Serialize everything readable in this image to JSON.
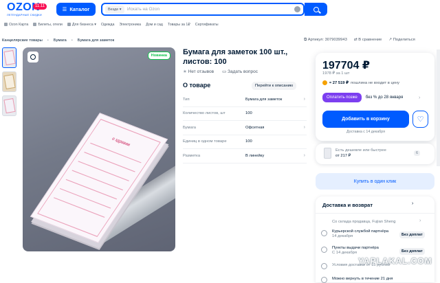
{
  "header": {
    "logo_word": "OZON",
    "logo_tag": "11.11",
    "logo_sub": "ЛЕГЕНДАРНЫЕ СКИДКИ",
    "catalog_label": "Каталог",
    "search_scope": "Везде",
    "search_placeholder": "Искать на Ozon"
  },
  "nav": [
    "Ozon Карта",
    "Билеты, отели",
    "Для бизнеса",
    "Одежда",
    "Электроника",
    "Дом и сад",
    "Товары за 1₽",
    "Сертификаты"
  ],
  "breadcrumbs": [
    "Канцелярские товары",
    "Бумага",
    "Бумага для заметок"
  ],
  "actions": {
    "article": "Артикул: 3079039943",
    "compare": "В сравнение",
    "share": "Поделиться"
  },
  "gallery": {
    "badge": "Новинка",
    "pad_title": "о здравии"
  },
  "product": {
    "title": "Бумага для заметок 100 шт., листов: 100",
    "reviews": "Нет отзывов",
    "ask": "Задать вопрос",
    "about_heading": "О товаре",
    "all_chars": "Перейти к описанию",
    "specs": [
      {
        "key": "Тип",
        "value": "Бумага для заметок"
      },
      {
        "key": "Количество листов, шт",
        "value": "100"
      },
      {
        "key": "Бумага",
        "value": "Офсетная"
      },
      {
        "key": "Единиц в одном товаре",
        "value": "100"
      },
      {
        "key": "Разметка",
        "value": "В линейку"
      }
    ]
  },
  "buybox": {
    "price": "197704 ₽",
    "per_unit": "1978 ₽ за 1 шт",
    "duty_amount": "≈ 27 519 ₽",
    "duty_text": "пошлина не входит в цену",
    "pay_later_button": "Оплатить позже",
    "pay_later_text": "без % до 28 января",
    "add_to_cart": "Добавить в корзину",
    "delivery_note": "Доставка с 14 декабря"
  },
  "cheaper": {
    "line1": "Есть дешевле или быстрее",
    "line2": "от 217 ₽",
    "count": "6"
  },
  "one_click": "Купить в один клик",
  "shipping": {
    "heading": "Доставка и возврат",
    "from": "Со склада продавца, Fujian Sheng",
    "options": [
      {
        "title": "Курьерской службой партнёра",
        "date": "14 декабря",
        "price": "Без доплат"
      },
      {
        "title": "Пункты выдачи партнёра",
        "date": "С 14 декабря",
        "price": "Без доплат"
      }
    ],
    "more": "Условия доставки от 15 рублей",
    "return": "Можно вернуть в течение 21 дня"
  },
  "watermark": "YAPLAKAL.COM"
}
